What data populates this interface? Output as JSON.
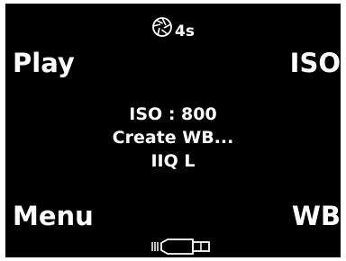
{
  "status": {
    "aperture_icon": "aperture-icon",
    "timer": "4s"
  },
  "softkeys": {
    "top_left": "Play",
    "top_right": "ISO",
    "bottom_left": "Menu",
    "bottom_right": "WB"
  },
  "info": {
    "iso": "ISO : 800",
    "white_balance": "Create WB...",
    "format": "IIQ L"
  },
  "battery": {
    "icon": "battery-icon"
  },
  "colors": {
    "background": "#000000",
    "foreground": "#ffffff"
  }
}
